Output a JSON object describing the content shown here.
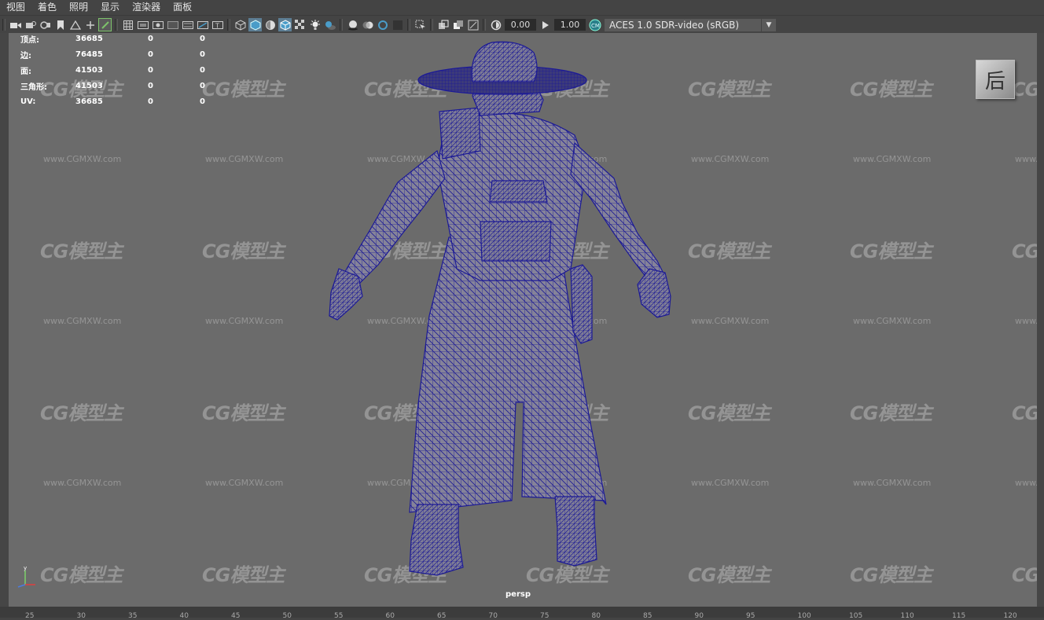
{
  "menu": [
    "视图",
    "着色",
    "照明",
    "显示",
    "渲染器",
    "面板"
  ],
  "toolbar": {
    "exposure_value": "0.00",
    "gamma_value": "1.00",
    "color_space": "ACES 1.0 SDR-video (sRGB)"
  },
  "hud_stats": [
    {
      "label": "顶点:",
      "v1": "36685",
      "v2": "0",
      "v3": "0"
    },
    {
      "label": "边:",
      "v1": "76485",
      "v2": "0",
      "v3": "0"
    },
    {
      "label": "面:",
      "v1": "41503",
      "v2": "0",
      "v3": "0"
    },
    {
      "label": "三角形:",
      "v1": "41503",
      "v2": "0",
      "v3": "0"
    },
    {
      "label": "UV:",
      "v1": "36685",
      "v2": "0",
      "v3": "0"
    }
  ],
  "viewcube_label": "后",
  "camera_name": "persp",
  "watermark": {
    "logo": "CG模型主",
    "url": "www.CGMXW.com"
  },
  "timeline_ticks": [
    "25",
    "30",
    "35",
    "40",
    "45",
    "50",
    "55",
    "60",
    "65",
    "70",
    "75",
    "80",
    "85",
    "90",
    "95",
    "100",
    "105",
    "110",
    "115",
    "120"
  ],
  "colors": {
    "wireframe": "#1c1a96",
    "viewport_bg": "#6b6b6b",
    "ui_bg": "#444444",
    "highlight": "#4a9cc8"
  },
  "icons": [
    "camera-icon",
    "bookmark-icon",
    "grid-icon",
    "film-gate-icon",
    "wireframe-icon",
    "smooth-shade-icon",
    "light-icon",
    "shadow-icon",
    "xray-icon",
    "isolate-icon",
    "exposure-icon",
    "gamma-icon",
    "color-management-icon"
  ]
}
